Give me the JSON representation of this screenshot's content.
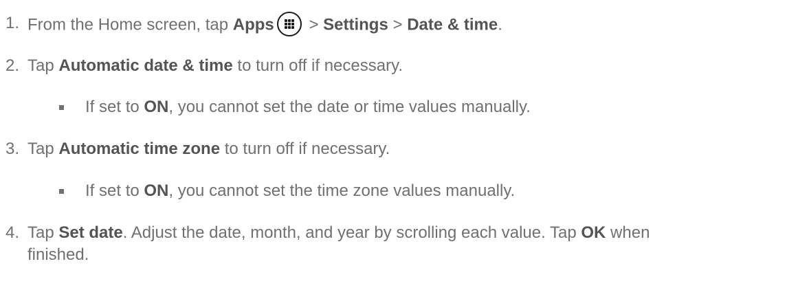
{
  "steps": [
    {
      "num": "1.",
      "parts": [
        {
          "t": "From the Home screen, tap ",
          "b": false
        },
        {
          "t": "Apps",
          "b": true
        },
        {
          "icon": "apps-grid-icon"
        },
        {
          "t": " > ",
          "b": false
        },
        {
          "t": "Settings",
          "b": true
        },
        {
          "t": " > ",
          "b": false
        },
        {
          "t": "Date & time",
          "b": true
        },
        {
          "t": ".",
          "b": false
        }
      ]
    },
    {
      "num": "2.",
      "parts": [
        {
          "t": "Tap ",
          "b": false
        },
        {
          "t": "Automatic date & time",
          "b": true
        },
        {
          "t": " to turn off if necessary.",
          "b": false
        }
      ],
      "bullet": [
        {
          "t": "If set to ",
          "b": false
        },
        {
          "t": "ON",
          "b": true
        },
        {
          "t": ", you cannot set the date or time values manually.",
          "b": false
        }
      ]
    },
    {
      "num": "3.",
      "parts": [
        {
          "t": "Tap ",
          "b": false
        },
        {
          "t": "Automatic time zone",
          "b": true
        },
        {
          "t": " to turn off if necessary.",
          "b": false
        }
      ],
      "bullet": [
        {
          "t": "If set to ",
          "b": false
        },
        {
          "t": "ON",
          "b": true
        },
        {
          "t": ", you cannot set the time zone values manually.",
          "b": false
        }
      ]
    },
    {
      "num": "4.",
      "parts": [
        {
          "t": "Tap ",
          "b": false
        },
        {
          "t": "Set date",
          "b": true
        },
        {
          "t": ". Adjust the date, month, and year by scrolling each value. Tap ",
          "b": false
        },
        {
          "t": "OK",
          "b": true
        },
        {
          "t": " when",
          "b": false
        }
      ],
      "cont": [
        {
          "t": "finished.",
          "b": false
        }
      ]
    }
  ]
}
